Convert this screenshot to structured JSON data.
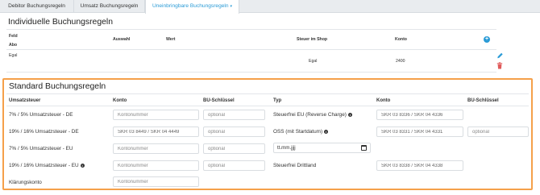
{
  "tabs": [
    {
      "label": "Debitor Buchungsregeln"
    },
    {
      "label": "Umsatz Buchungsregeln"
    },
    {
      "label": "Uneinbringbare Buchungsregeln",
      "caret": "▾"
    }
  ],
  "individual": {
    "title": "Individuelle Buchungsregeln",
    "headers": {
      "feld": "Feld",
      "abo": "Abo",
      "auswahl": "Auswahl",
      "wert": "Wert",
      "steuer": "Steuer im Shop",
      "konto": "Konto"
    },
    "rows": [
      {
        "feld": "Egal",
        "steuer": "Egal",
        "konto": "2400"
      }
    ],
    "add_icon": "plus-circle-icon",
    "edit_icon": "pencil-icon",
    "delete_icon": "trash-icon"
  },
  "standard": {
    "title": "Standard Buchungsregeln",
    "headers": {
      "umsatzsteuer": "Umsatzsteuer",
      "konto": "Konto",
      "bu": "BU-Schlüssel",
      "typ": "Typ",
      "konto2": "Konto",
      "bu2": "BU-Schlüssel"
    },
    "rows": [
      {
        "label": "7% / 5% Umsatzsteuer - DE",
        "konto_placeholder": "Kontonummer",
        "konto_value": "",
        "bu_placeholder": "optional",
        "typ": "Steuerfrei EU (Reverse Charge)",
        "typ_info": true,
        "konto2_value": "SKR 03 8336 / SKR 04 4336"
      },
      {
        "label": "19% / 16% Umsatzsteuer - DE",
        "konto_value": "SKR 03 8449 / SKR 04 4449",
        "bu_placeholder": "optional",
        "typ": "OSS (mit Startdatum)",
        "typ_info": true,
        "konto2_value": "SKR 03 8331 / SKR 04 4331",
        "bu2_placeholder": "optional"
      },
      {
        "label": "7% / 5% Umsatzsteuer - EU",
        "konto_placeholder": "Kontonummer",
        "bu_placeholder": "optional",
        "date_placeholder": "tt.mm.jjjj"
      },
      {
        "label": "19% / 16% Umsatzsteuer - EU",
        "label_info": true,
        "konto_placeholder": "Kontonummer",
        "bu_placeholder": "optional",
        "typ": "Steuerfrei Drittland",
        "konto2_value": "SKR 03 8338 / SKR 04 4338"
      },
      {
        "label": "Klärungskonto",
        "konto_placeholder": "Kontonummer"
      }
    ]
  },
  "colors": {
    "accent": "#2a9bd6",
    "highlight_border": "#f5a04a",
    "delete": "#e05a5a"
  }
}
